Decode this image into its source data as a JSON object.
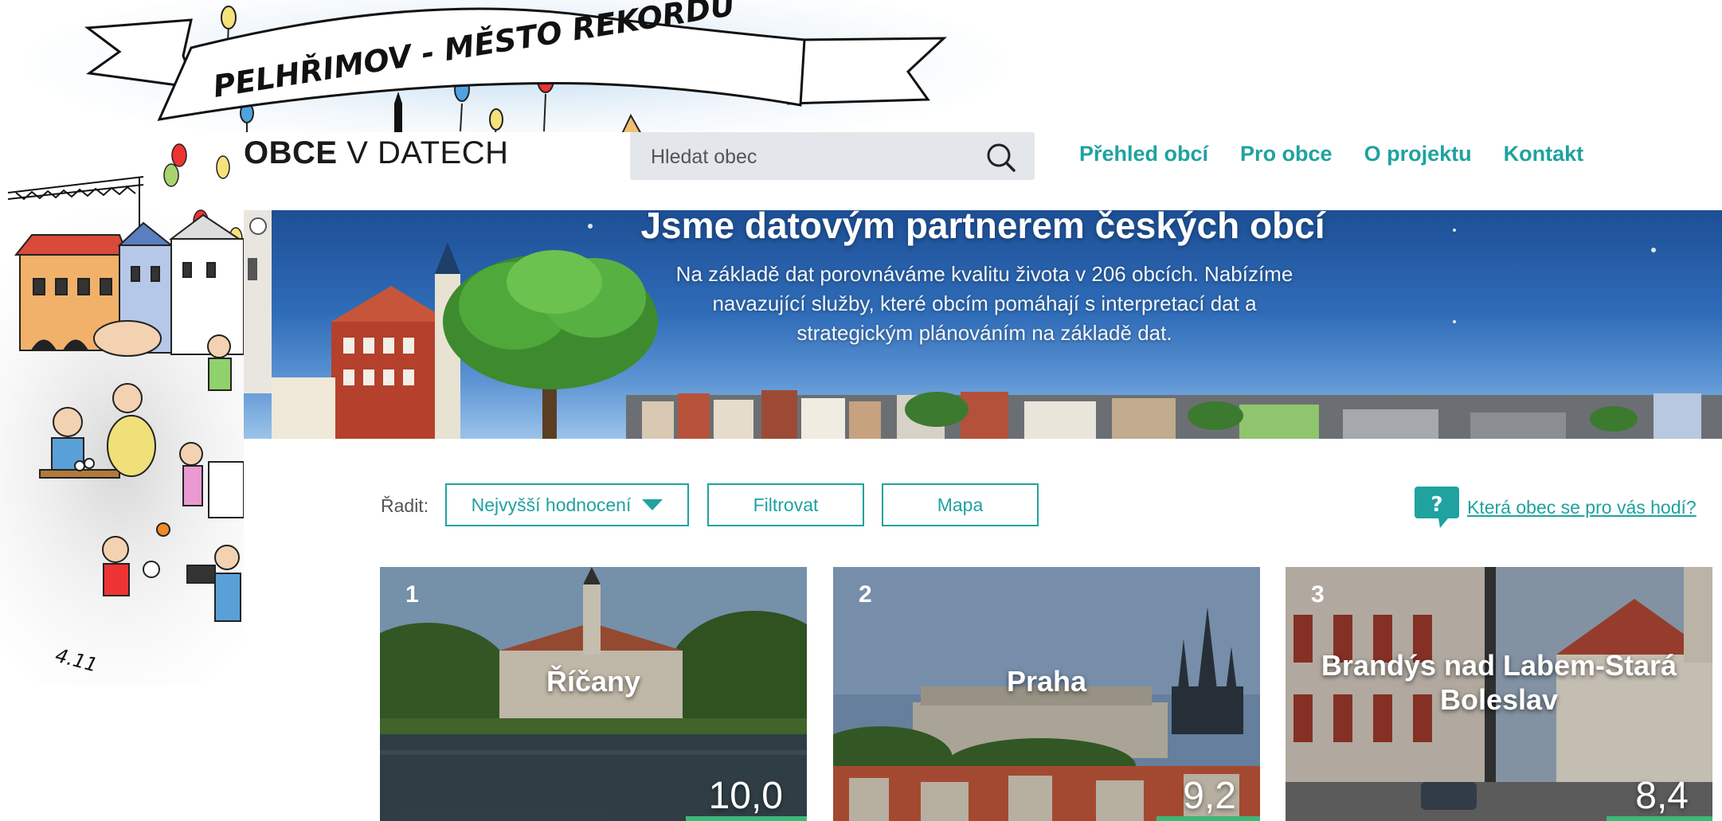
{
  "cartoon": {
    "banner_text": "PELHŘIMOV - MĚSTO REKORDŮ",
    "signature": "4.11"
  },
  "header": {
    "logo_bold": "OBCE",
    "logo_light": "V DATECH",
    "search_placeholder": "Hledat obec",
    "nav": [
      "Přehled obcí",
      "Pro obce",
      "O projektu",
      "Kontakt"
    ]
  },
  "hero": {
    "title": "Jsme datovým partnerem českých obcí",
    "text": "Na základě dat porovnáváme kvalitu života v 206 obcích. Nabízíme navazující služby, které obcím pomáhají s interpretací dat a strategickým plánováním na základě dat."
  },
  "controls": {
    "sort_label": "Řadit:",
    "sort_value": "Nejvyšší hodnocení",
    "filter_label": "Filtrovat",
    "map_label": "Mapa",
    "help_link": "Která obec se pro vás hodí?"
  },
  "cards": [
    {
      "rank": "1",
      "name": "Říčany",
      "score": "10,0"
    },
    {
      "rank": "2",
      "name": "Praha",
      "score": "9,2"
    },
    {
      "rank": "3",
      "name": "Brandýs nad Labem-Stará Boleslav",
      "score": "8,4"
    }
  ],
  "colors": {
    "accent": "#1fa2a0",
    "score_bar": "#3cb878",
    "search_bg": "#e3e6ea"
  }
}
